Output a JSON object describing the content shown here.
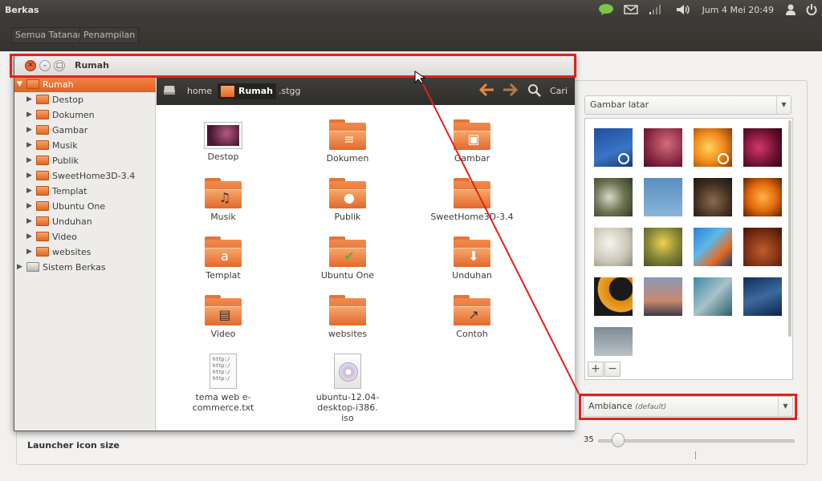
{
  "top_panel": {
    "app_title": "Berkas",
    "clock": "Jum 4 Mei 20:49",
    "indicators": [
      "chat-icon",
      "mail-icon",
      "network-icon",
      "volume-icon",
      "user-icon",
      "power-icon"
    ]
  },
  "settings_toolbar": {
    "buttons": [
      "Semua Tatanan",
      "Penampilan"
    ]
  },
  "settings": {
    "wallpaper_combo": "Gambar latar",
    "theme_combo": "Ambiance",
    "theme_default": "(default)",
    "launcher_icon_label": "Launcher icon size",
    "launcher_icon_size": "35",
    "launcher_slider_fraction": 0.1,
    "add_label": "+",
    "remove_label": "−"
  },
  "file_manager": {
    "title": "Rumah",
    "sidebar": [
      {
        "label": "Rumah",
        "selected": true
      },
      {
        "label": "Destop"
      },
      {
        "label": "Dokumen"
      },
      {
        "label": "Gambar"
      },
      {
        "label": "Musik"
      },
      {
        "label": "Publik"
      },
      {
        "label": "SweetHome3D-3.4"
      },
      {
        "label": "Templat"
      },
      {
        "label": "Ubuntu One"
      },
      {
        "label": "Unduhan"
      },
      {
        "label": "Video"
      },
      {
        "label": "websites"
      },
      {
        "label": "Sistem Berkas"
      }
    ],
    "pathbar": {
      "crumbs": [
        "home",
        "Rumah",
        ".stgg"
      ],
      "search_label": "Cari"
    },
    "files": [
      {
        "label": "Destop",
        "kind": "desktop"
      },
      {
        "label": "Dokumen",
        "kind": "folder",
        "emblem": "documents"
      },
      {
        "label": "Gambar",
        "kind": "folder",
        "emblem": "pictures"
      },
      {
        "label": "Musik",
        "kind": "folder",
        "emblem": "music"
      },
      {
        "label": "Publik",
        "kind": "folder",
        "emblem": "public"
      },
      {
        "label": "SweetHome3D-3.4",
        "kind": "folder"
      },
      {
        "label": "Templat",
        "kind": "folder",
        "emblem": "templates"
      },
      {
        "label": "Ubuntu One",
        "kind": "folder",
        "emblem": "check"
      },
      {
        "label": "Unduhan",
        "kind": "folder",
        "emblem": "download"
      },
      {
        "label": "Video",
        "kind": "folder",
        "emblem": "video"
      },
      {
        "label": "websites",
        "kind": "folder"
      },
      {
        "label": "Contoh",
        "kind": "folder",
        "emblem": "link"
      },
      {
        "label": "tema web e-commerce.txt",
        "kind": "text",
        "preview": [
          "http:/",
          "http:/",
          "http:/",
          "http:/"
        ]
      },
      {
        "label": "ubuntu-12.04-desktop-i386.\niso",
        "kind": "disc"
      }
    ]
  },
  "colors": {
    "accent": "#e2211c",
    "ubuntu_orange": "#e06121",
    "panel_dark": "#3c3b37"
  }
}
